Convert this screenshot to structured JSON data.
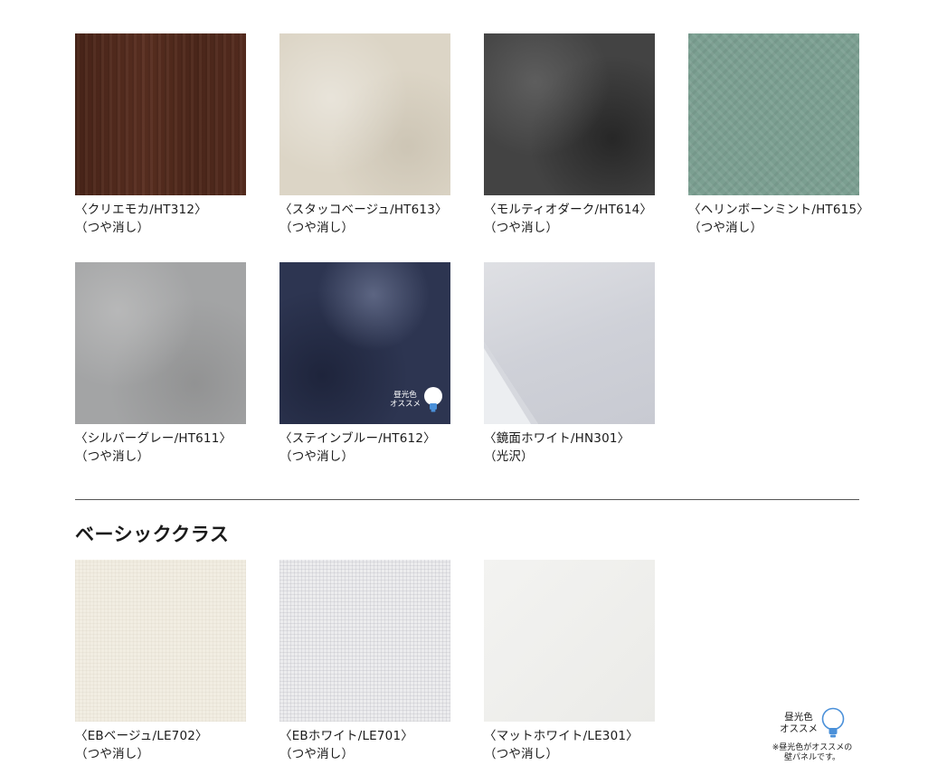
{
  "rows": [
    [
      {
        "name": "〈クリエモカ/HT312〉",
        "finish": "（つや消し）",
        "texture": "wood"
      },
      {
        "name": "〈スタッコベージュ/HT613〉",
        "finish": "（つや消し）",
        "texture": "stucco"
      },
      {
        "name": "〈モルティオダーク/HT614〉",
        "finish": "（つや消し）",
        "texture": "dark"
      },
      {
        "name": "〈ヘリンボーンミント/HT615〉",
        "finish": "（つや消し）",
        "texture": "herringbone"
      }
    ],
    [
      {
        "name": "〈シルバーグレー/HT611〉",
        "finish": "（つや消し）",
        "texture": "silver"
      },
      {
        "name": "〈ステインブルー/HT612〉",
        "finish": "（つや消し）",
        "texture": "blue"
      },
      {
        "name": "〈鏡面ホワイト/HN301〉",
        "finish": "（光沢）",
        "texture": "mirror"
      }
    ]
  ],
  "badge": {
    "line1": "昼光色",
    "line2": "オススメ",
    "icon": "lightbulb-icon"
  },
  "section": {
    "title": "ベーシッククラス"
  },
  "basic": [
    {
      "name": "〈EBベージュ/LE702〉",
      "finish": "（つや消し）",
      "texture": "eb-beige"
    },
    {
      "name": "〈EBホワイト/LE701〉",
      "finish": "（つや消し）",
      "texture": "eb-white"
    },
    {
      "name": "〈マットホワイト/LE301〉",
      "finish": "（つや消し）",
      "texture": "matte-white"
    }
  ],
  "legend": {
    "line1": "昼光色",
    "line2": "オススメ",
    "note1": "※昼光色がオススメの",
    "note2": "壁パネルです。"
  },
  "colors": {
    "bulb_blue": "#4a90d9"
  }
}
